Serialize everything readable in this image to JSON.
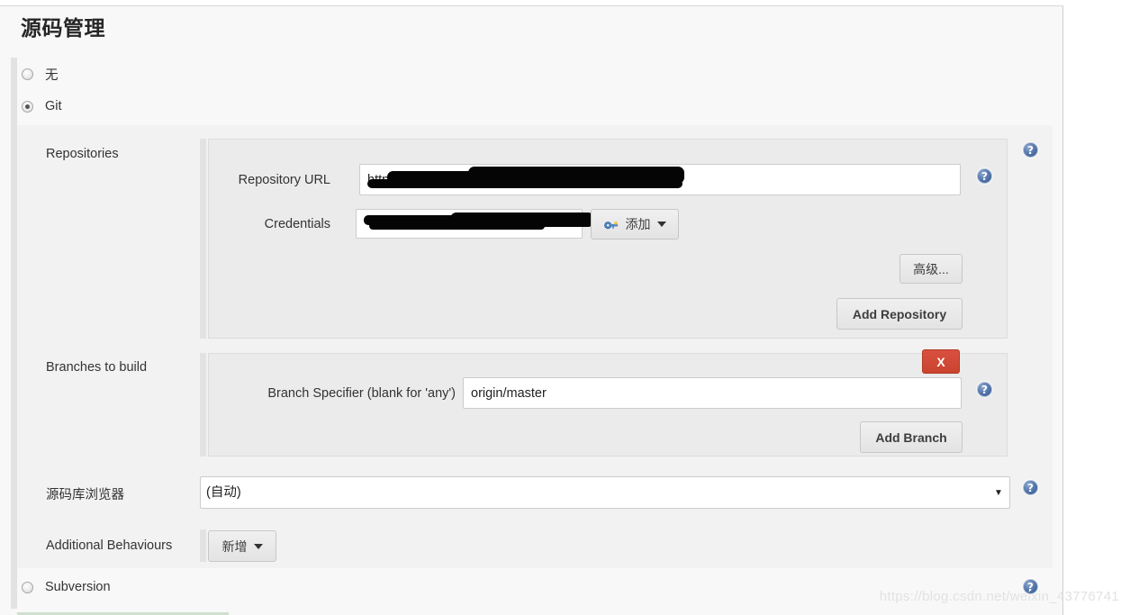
{
  "page": {
    "title": "源码管理",
    "watermark": "https://blog.csdn.net/weixin_43776741"
  },
  "scm_options": [
    {
      "label": "无",
      "selected": false
    },
    {
      "label": "Git",
      "selected": true
    },
    {
      "label": "Subversion",
      "selected": false
    }
  ],
  "git": {
    "repositories": {
      "section_label": "Repositories",
      "repository_url": {
        "label": "Repository URL",
        "value": "http://",
        "redacted": true
      },
      "credentials": {
        "label": "Credentials",
        "value": "",
        "redacted": true
      },
      "add_credentials_button": {
        "label": "添加",
        "icon": "key-icon",
        "caret": true
      },
      "advanced_button": "高级...",
      "add_repository_button": "Add Repository"
    },
    "branches": {
      "section_label": "Branches to build",
      "delete_button": "X",
      "branch_specifier": {
        "label": "Branch Specifier (blank for 'any')",
        "value": "origin/master"
      },
      "add_branch_button": "Add Branch"
    },
    "repository_browser": {
      "section_label": "源码库浏览器",
      "selected": "(自动)",
      "options": [
        "(自动)"
      ]
    },
    "additional_behaviours": {
      "section_label": "Additional Behaviours",
      "add_button": "新增"
    }
  },
  "help_icons": {
    "glyph": "?",
    "items": [
      "repositories-help",
      "repository-url-help",
      "branch-specifier-help",
      "repository-browser-help",
      "additional-behaviours-help"
    ]
  },
  "colors": {
    "danger": "#c9432f",
    "help_blue": "#31548c",
    "panel_bg": "#f2f2f2",
    "subpanel_bg": "#ebebeb"
  }
}
